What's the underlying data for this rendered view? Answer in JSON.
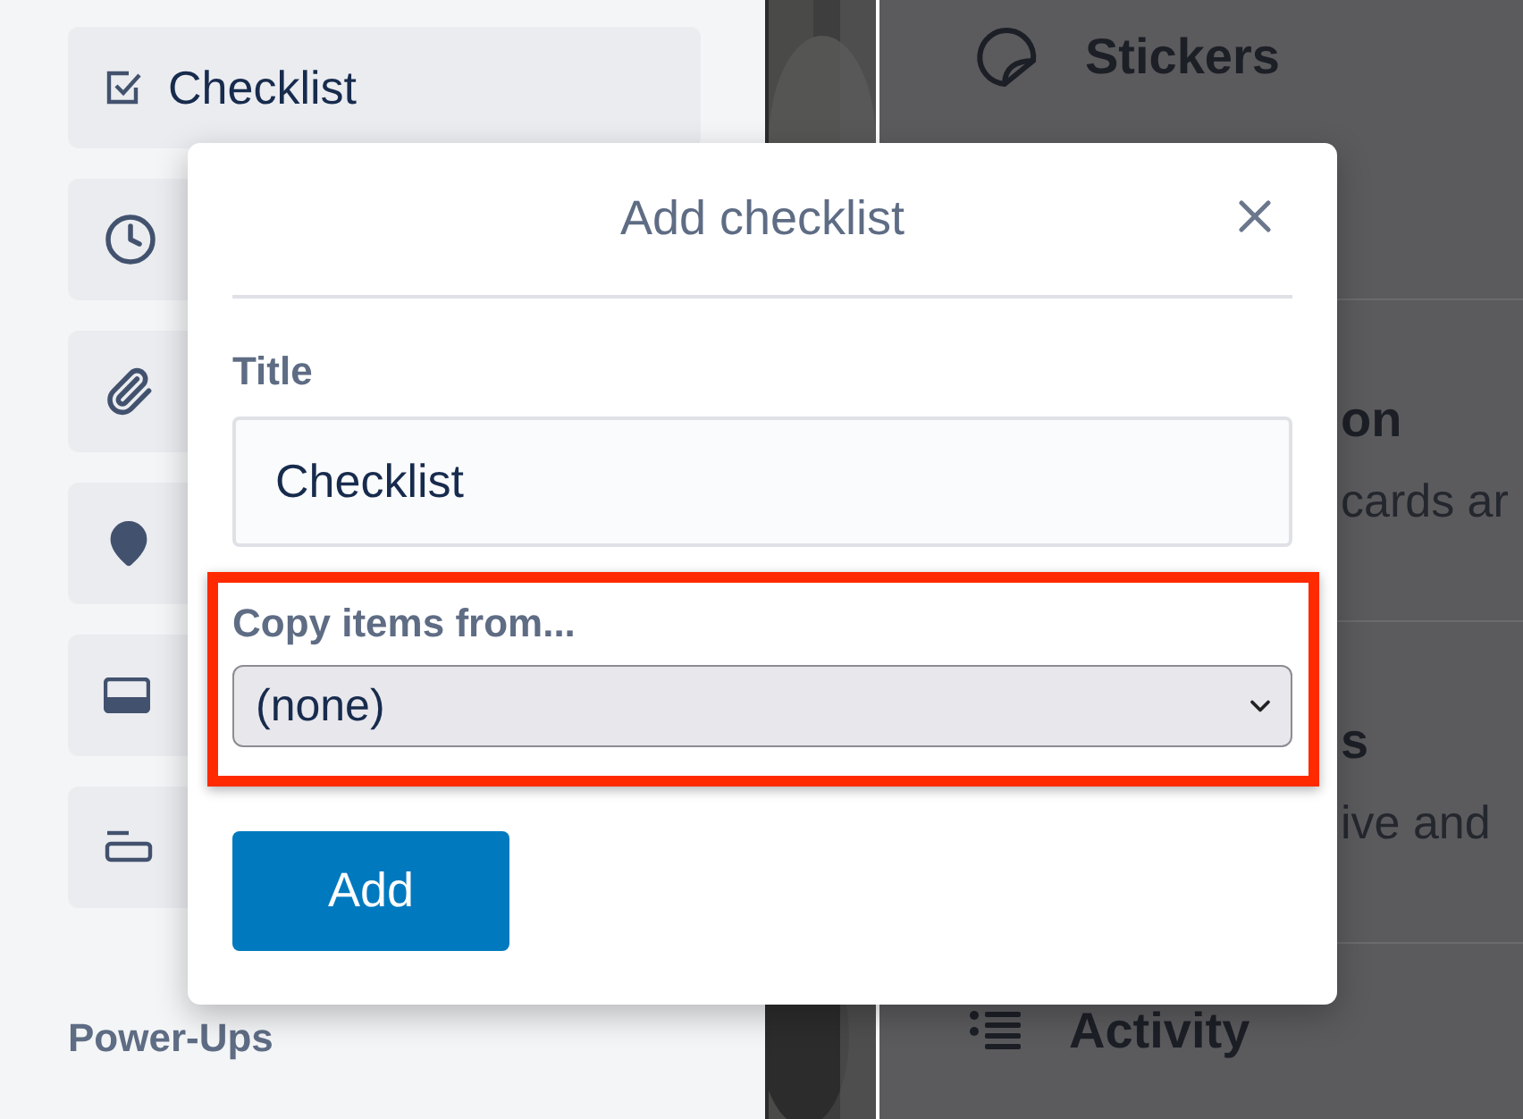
{
  "sidebar": {
    "items": [
      {
        "kind": "checkbox",
        "label": "Checklist"
      },
      {
        "kind": "clock"
      },
      {
        "kind": "paperclip"
      },
      {
        "kind": "pin"
      },
      {
        "kind": "card"
      },
      {
        "kind": "bars"
      }
    ],
    "section_heading": "Power-Ups"
  },
  "side_panel": {
    "items": [
      {
        "kind": "sticker",
        "title": "Stickers"
      },
      {
        "kind": "text",
        "title": "on",
        "description": "cards ar"
      },
      {
        "kind": "text",
        "title": "s",
        "description": "ive and"
      },
      {
        "kind": "list",
        "title": "Activity"
      }
    ]
  },
  "dialog": {
    "title": "Add checklist",
    "fields": [
      {
        "kind": "input",
        "label": "Title",
        "value": "Checklist"
      },
      {
        "kind": "select",
        "label": "Copy items from...",
        "value": "(none)",
        "highlighted": true
      }
    ],
    "button": "Add"
  }
}
